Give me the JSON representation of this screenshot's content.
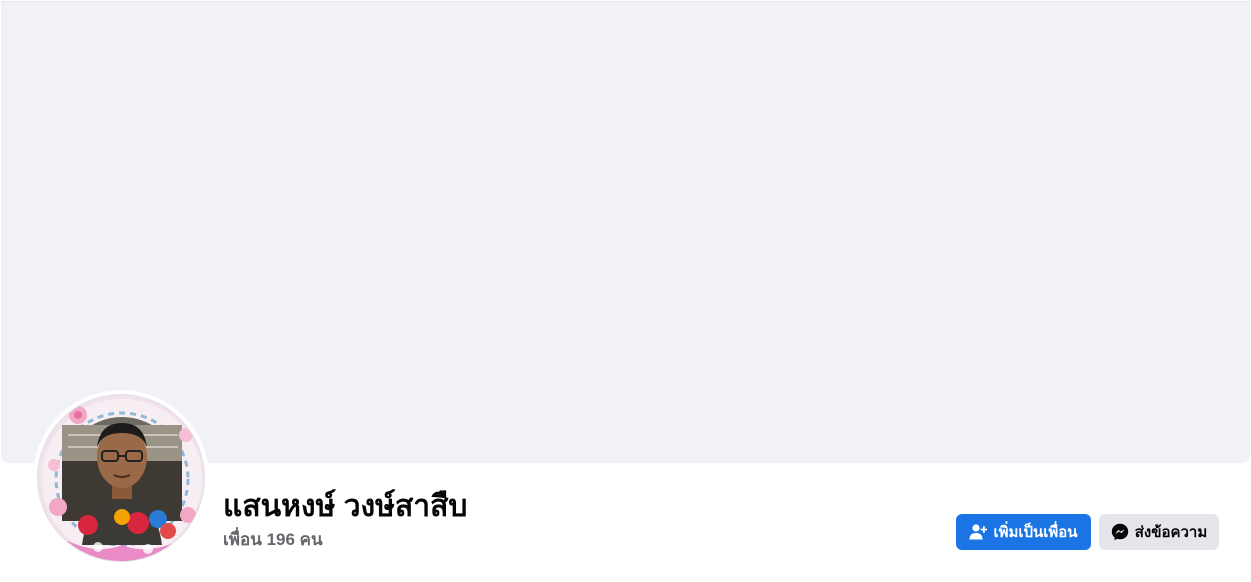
{
  "profile": {
    "name": "แสนหงษ์ วงษ์สาสืบ",
    "friends": "เพื่อน 196 คน"
  },
  "actions": {
    "add_friend_label": "เพิ่มเป็นเพื่อน",
    "message_label": "ส่งข้อความ"
  },
  "colors": {
    "primary": "#1b74e4",
    "cover_bg": "#f0f2f5",
    "secondary_button": "#e4e6eb"
  },
  "icons": {
    "add_friend": "person-add-icon",
    "message": "messenger-icon"
  }
}
